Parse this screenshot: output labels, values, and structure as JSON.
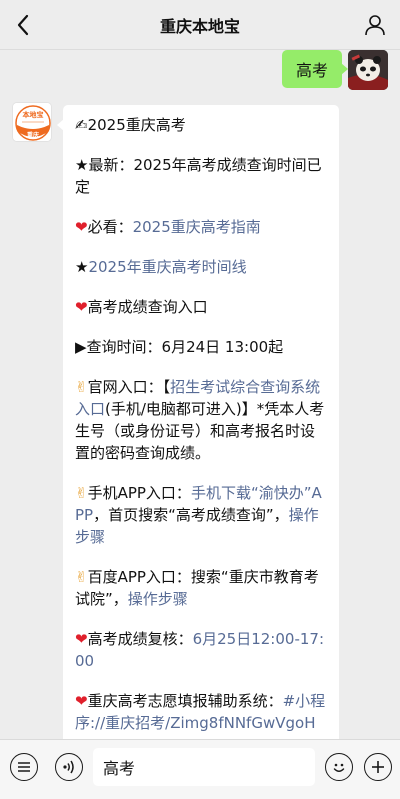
{
  "header": {
    "title": "重庆本地宝"
  },
  "chat": {
    "sent_message": "高考",
    "received_avatar": {
      "top_text": "本地宝",
      "bottom_text": "重庆"
    },
    "paragraphs": {
      "p1": {
        "emoji": "✍",
        "text": "2025重庆高考"
      },
      "p2": {
        "text": "★最新：2025年高考成绩查询时间已定"
      },
      "p3": {
        "emoji": "❤",
        "text": "必看：",
        "link": "2025重庆高考指南"
      },
      "p4": {
        "star": "★",
        "link": "2025年重庆高考时间线"
      },
      "p5": {
        "emoji": "❤",
        "text": "高考成绩查询入口"
      },
      "p6": {
        "text": "▶查询时间：6月24日 13:00起"
      },
      "p7": {
        "emoji": "✌",
        "text_before": "官网入口：【",
        "link": "招生考试综合查询系统入口",
        "text_after": "(手机/电脑都可进入)】*凭本人考生号（或身份证号）和高考报名时设置的密码查询成绩。"
      },
      "p8": {
        "emoji": "✌",
        "text_before": "手机APP入口：",
        "link1": "手机下载“渝快办”APP",
        "text_mid": "，首页搜索“高考成绩查询”，",
        "link2": "操作步骤"
      },
      "p9": {
        "emoji": "✌",
        "text_before": "百度APP入口：搜索“重庆市教育考试院”，",
        "link": "操作步骤"
      },
      "p10": {
        "emoji": "❤",
        "text": "高考成绩复核：",
        "link": "6月25日12:00-17:00"
      },
      "p11": {
        "emoji": "❤",
        "text": "重庆高考志愿填报辅助系统：",
        "link": "#小程序://重庆招考/Zimg8fNNfGwVgoH"
      }
    }
  },
  "footer": {
    "input_value": "高考"
  },
  "colors": {
    "link": "#576b95",
    "sent_bubble": "#95ec69",
    "background": "#ededed",
    "brand_orange": "#ee6a1f"
  }
}
